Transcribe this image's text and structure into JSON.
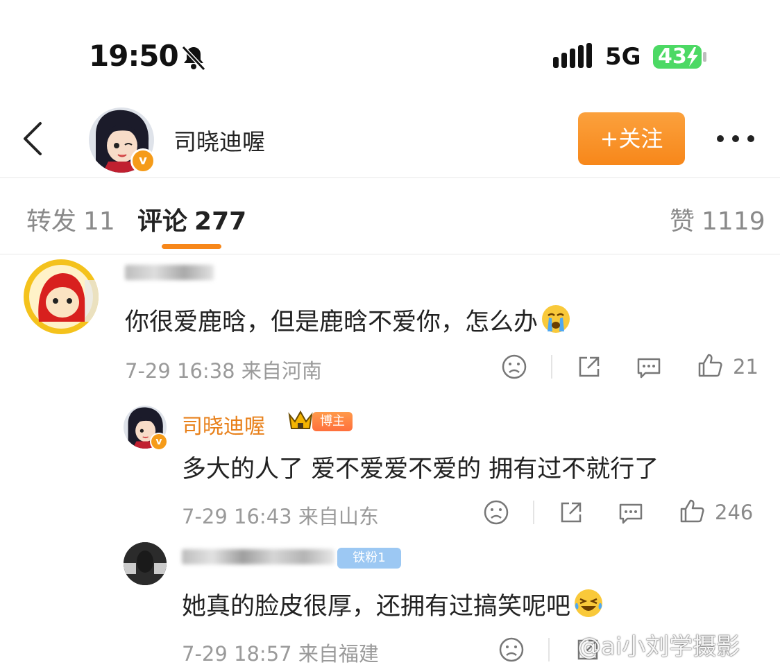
{
  "status_bar": {
    "time": "19:50",
    "network": "5G",
    "battery": "43"
  },
  "header": {
    "name": "司晓迪喔",
    "follow_label": "+关注",
    "verified_badge": "v"
  },
  "tabs": [
    {
      "label": "转发",
      "count": "11"
    },
    {
      "label": "评论",
      "count": "277"
    },
    {
      "label": "赞",
      "count": "1119"
    }
  ],
  "comments": [
    {
      "text": "你很爱鹿晗，但是鹿晗不爱你，怎么办",
      "meta": "7-29 16:38 来自河南",
      "likes": "21",
      "emoji": "crying-face"
    },
    {
      "name": "司晓迪喔",
      "tag": "博主",
      "text": "多大的人了 爱不爱爱不爱的 拥有过不就行了",
      "meta": "7-29 16:43 来自山东",
      "likes": "246"
    },
    {
      "fan_tag": "铁粉1",
      "text": "她真的脸皮很厚，还拥有过搞笑呢吧",
      "meta": "7-29 18:57 来自福建",
      "emoji": "laughing-crying-face"
    }
  ],
  "watermark": "@ai小刘学摄影",
  "colors": {
    "accent": "#f7871a",
    "meta": "#9a9a9a",
    "name_orange": "#e8801a"
  }
}
